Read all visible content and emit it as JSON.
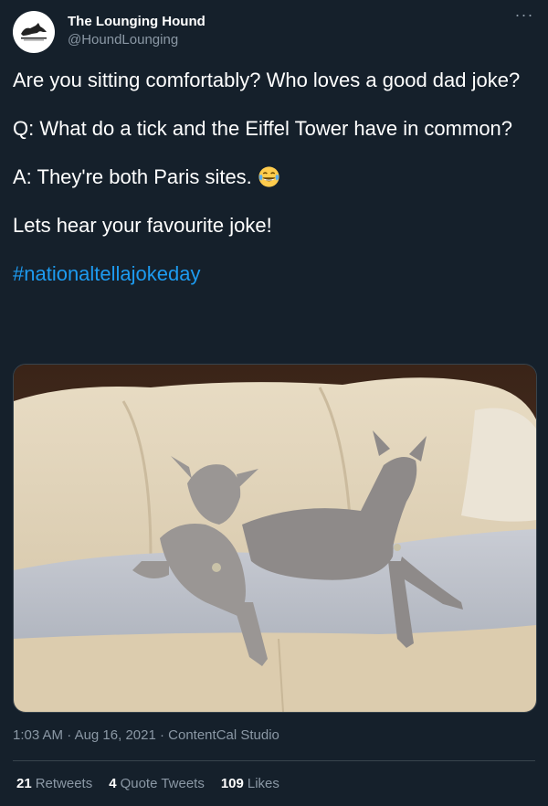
{
  "account": {
    "display_name": "The Lounging Hound",
    "handle": "@HoundLounging",
    "avatar_icon": "dog-logo-icon",
    "avatar_logo_text": "THE LOUNGING HOUND"
  },
  "more_icon": "more-options-icon",
  "tweet": {
    "paragraph_1": "Are you sitting comfortably? Who loves a good dad joke?",
    "paragraph_2": "Q: What do a tick and the Eiffel Tower have in common?",
    "paragraph_3": "A: They're both Paris sites.",
    "paragraph_3_emoji": "tears-of-joy-emoji",
    "paragraph_4": "Lets hear your favourite joke!",
    "hashtag": "#nationaltellajokeday",
    "media_icon": "photo-two-greyhounds-on-sofa"
  },
  "meta": {
    "time": "1:03 AM",
    "sep1": "·",
    "date": "Aug 16, 2021",
    "sep2": "·",
    "source": "ContentCal Studio"
  },
  "stats": {
    "retweets_count": "21",
    "retweets_label": "Retweets",
    "quotes_count": "4",
    "quotes_label": "Quote Tweets",
    "likes_count": "109",
    "likes_label": "Likes"
  },
  "colors": {
    "background": "#15202b",
    "link": "#1d9bf0",
    "secondary_text": "#8b98a5",
    "divider": "#38444d"
  }
}
